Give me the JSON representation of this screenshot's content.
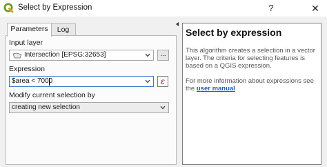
{
  "window": {
    "title": "Select by Expression",
    "help_glyph": "?",
    "close_glyph": "✕",
    "icon": "qgis-logo-icon"
  },
  "tabs": [
    {
      "label": "Parameters",
      "active": true
    },
    {
      "label": "Log",
      "active": false
    }
  ],
  "params": {
    "input_layer_label": "Input layer",
    "input_layer_value": "Intersection [EPSG:32653]",
    "input_layer_browse": "...",
    "expression_label": "Expression",
    "expression_value": "$area < 7000",
    "modify_label": "Modify current selection by",
    "modify_value": "creating new selection"
  },
  "help": {
    "title": "Select by expression",
    "description": "This algorithm creates a selection in a vector layer. The criteria for selecting features is based on a QGIS expression.",
    "more_prefix": "For more information about expressions see the",
    "link_text": "user manual"
  },
  "colors": {
    "window_bg": "#f0f0f0",
    "link": "#1a5fb4",
    "epsilon": "#8a2b3a",
    "qgis_green": "#6a9a2a"
  }
}
